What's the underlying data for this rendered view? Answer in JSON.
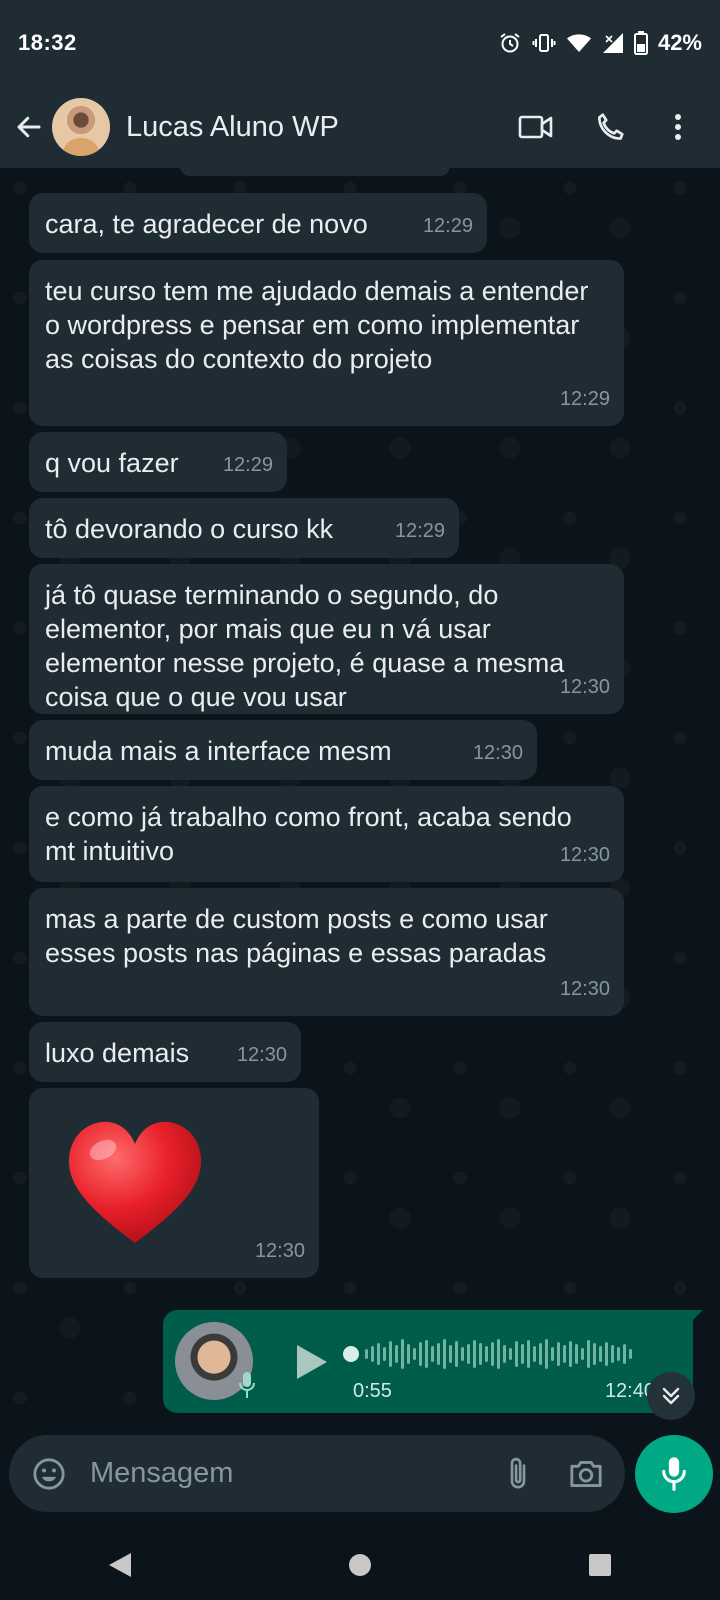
{
  "status_bar": {
    "time": "18:32",
    "battery": "42%",
    "icons": [
      "alarm-icon",
      "vibrate-icon",
      "wifi-icon",
      "signal-icon",
      "battery-icon"
    ]
  },
  "header": {
    "contact_name": "Lucas Aluno WP",
    "icons": [
      "back-arrow-icon",
      "video-call-icon",
      "phone-icon",
      "more-options-icon"
    ]
  },
  "messages": [
    {
      "text": "cara, te agradecer de novo",
      "time": "12:29"
    },
    {
      "text": "teu curso tem me ajudado demais a entender o wordpress e pensar em como implementar as coisas do contexto do projeto",
      "time": "12:29"
    },
    {
      "text": "q vou fazer",
      "time": "12:29"
    },
    {
      "text": "tô devorando o curso kk",
      "time": "12:29"
    },
    {
      "text": "já tô quase terminando o segundo, do elementor, por mais que eu n vá usar elementor nesse projeto, é quase a mesma coisa que o que vou usar",
      "time": "12:30"
    },
    {
      "text": "muda mais a interface mesm",
      "time": "12:30"
    },
    {
      "text": "e como já trabalho como front, acaba sendo mt intuitivo",
      "time": "12:30"
    },
    {
      "text": "mas a parte de custom posts e como usar esses posts nas páginas e essas paradas",
      "time": "12:30"
    },
    {
      "text": "luxo demais",
      "time": "12:30"
    },
    {
      "emoji": "heart",
      "time": "12:30"
    }
  ],
  "voice_note": {
    "duration": "0:55",
    "time": "12:40",
    "direction": "outgoing"
  },
  "composer": {
    "placeholder": "Mensagem",
    "icons": [
      "emoji-icon",
      "attach-icon",
      "camera-icon",
      "mic-icon"
    ]
  },
  "colors": {
    "background": "#0b141a",
    "bar": "#1f2c34",
    "incoming_bubble": "#202c33",
    "outgoing_bubble": "#005c4b",
    "accent": "#00a884",
    "meta_text": "#8696a0"
  }
}
